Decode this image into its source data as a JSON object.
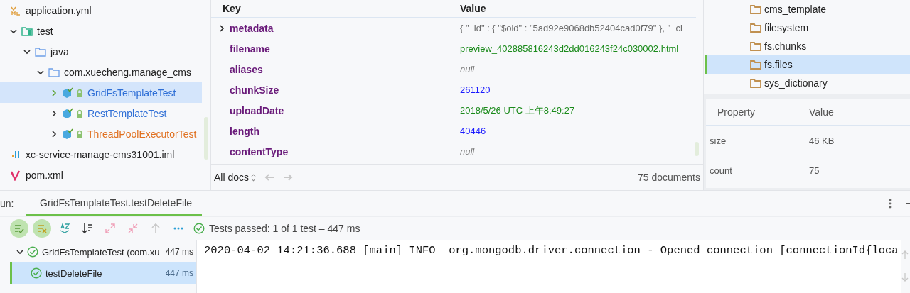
{
  "project_tree": [
    {
      "label": "application.yml",
      "kind": "yaml",
      "selected": false
    },
    {
      "label": "test",
      "kind": "test-root",
      "expanded": true,
      "selected": false,
      "children": [
        {
          "label": "java",
          "kind": "folder",
          "expanded": true,
          "selected": false,
          "children": [
            {
              "label": "com.xuecheng.manage_cms",
              "kind": "package",
              "expanded": true,
              "selected": false,
              "children": [
                {
                  "label": "GridFsTemplateTest",
                  "kind": "test-class",
                  "expanded": false,
                  "selected": true,
                  "color": "#2f6fd6"
                },
                {
                  "label": "RestTemplateTest",
                  "kind": "test-class",
                  "expanded": false,
                  "selected": false,
                  "color": "#2f6fd6"
                },
                {
                  "label": "ThreadPoolExecutorTest",
                  "kind": "test-class",
                  "expanded": false,
                  "selected": false,
                  "color": "#e0701f"
                }
              ]
            }
          ]
        }
      ]
    },
    {
      "label": "xc-service-manage-cms31001.iml",
      "kind": "iml",
      "selected": false
    },
    {
      "label": "pom.xml",
      "kind": "maven",
      "selected": false
    }
  ],
  "document": {
    "columns": [
      "Key",
      "Value"
    ],
    "rows": [
      {
        "key": "metadata",
        "value": "{ \"_id\" : { \"$oid\" : \"5ad92e9068db52404cad0f79\" }, \"_cl",
        "kind": "object",
        "expanded": false
      },
      {
        "key": "filename",
        "value": "preview_402885816243d2dd016243f24c030002.html",
        "kind": "string"
      },
      {
        "key": "aliases",
        "value": "null",
        "kind": "null"
      },
      {
        "key": "chunkSize",
        "value": "261120",
        "kind": "number"
      },
      {
        "key": "uploadDate",
        "value": "2018/5/26 UTC 上午8:49:27",
        "kind": "date"
      },
      {
        "key": "length",
        "value": "40446",
        "kind": "number"
      },
      {
        "key": "contentType",
        "value": "null",
        "kind": "null"
      }
    ],
    "filter": "All docs",
    "count": "75 documents"
  },
  "collections": [
    {
      "label": "cms_template",
      "selected": false
    },
    {
      "label": "filesystem",
      "selected": false
    },
    {
      "label": "fs.chunks",
      "selected": false
    },
    {
      "label": "fs.files",
      "selected": true
    },
    {
      "label": "sys_dictionary",
      "selected": false
    }
  ],
  "properties": {
    "columns": [
      "Property",
      "Value"
    ],
    "rows": [
      {
        "property": "size",
        "value": "46 KB"
      },
      {
        "property": "count",
        "value": "75"
      }
    ]
  },
  "run": {
    "label": "un:",
    "tab": "GridFsTemplateTest.testDeleteFile",
    "toolbar": [
      {
        "kind": "show-passed",
        "on": true
      },
      {
        "kind": "show-ignored",
        "on": true
      },
      {
        "kind": "sort-alpha",
        "on": false
      },
      {
        "kind": "sort-duration",
        "on": false
      },
      {
        "kind": "expand-all",
        "on": false
      },
      {
        "kind": "collapse-all",
        "on": false
      },
      {
        "kind": "previous",
        "on": false
      },
      {
        "kind": "more",
        "on": false
      }
    ],
    "status": "Tests passed: 1 of 1 test – 447 ms",
    "tests": [
      {
        "label": "GridFsTemplateTest (com.xu",
        "time": "447 ms",
        "expanded": true,
        "selected": false,
        "passed": true,
        "children": [
          {
            "label": "testDeleteFile",
            "time": "447 ms",
            "selected": true,
            "passed": true
          }
        ]
      }
    ],
    "console": [
      "2020-04-02 14:21:36.688 [main] INFO  org.mongodb.driver.connection - Opened connection [connectionId{loca"
    ]
  }
}
